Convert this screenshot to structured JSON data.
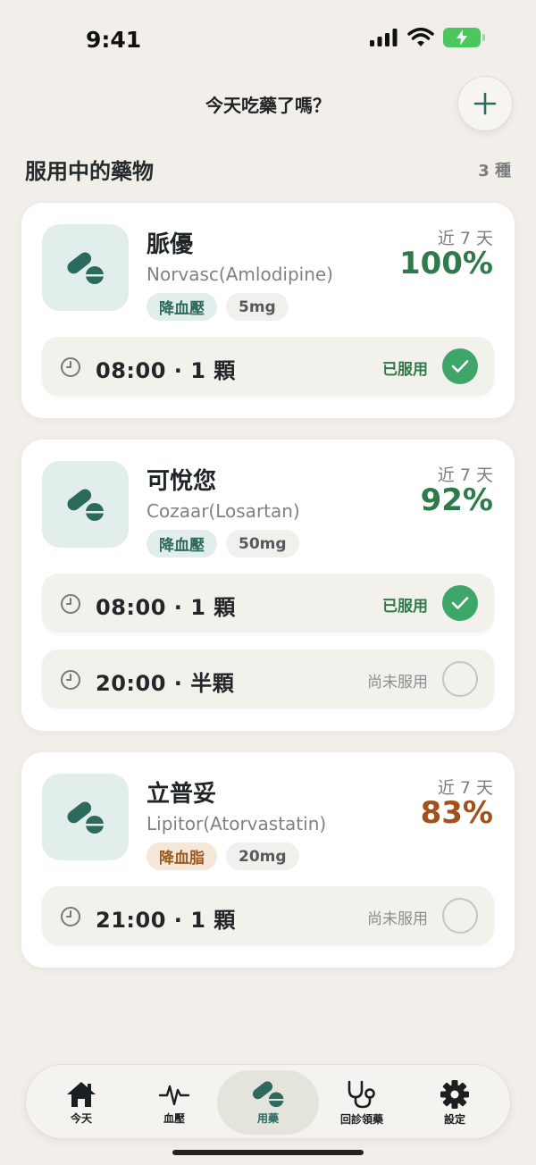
{
  "status_bar": {
    "time": "9:41"
  },
  "header": {
    "title": "今天吃藥了嗎？",
    "add_icon": "plus-icon"
  },
  "section": {
    "title": "服用中的藥物",
    "count": "3 種"
  },
  "colors": {
    "accent": "#2d6a5e",
    "taken": "#3fa66a",
    "good": "#2f7a4b",
    "warn": "#a0511c"
  },
  "medications": [
    {
      "name": "脈優",
      "generic": "Norvasc(Amlodipine)",
      "category": "降血壓",
      "dose": "5mg",
      "adherence_label": "近 7 天",
      "adherence": "100%",
      "doses": [
        {
          "time_text": "08:00 · 1 顆",
          "status": "已服用",
          "taken": true
        }
      ]
    },
    {
      "name": "可悅您",
      "generic": "Cozaar(Losartan)",
      "category": "降血壓",
      "dose": "50mg",
      "adherence_label": "近 7 天",
      "adherence": "92%",
      "doses": [
        {
          "time_text": "08:00 · 1 顆",
          "status": "已服用",
          "taken": true
        },
        {
          "time_text": "20:00 · 半顆",
          "status": "尚未服用",
          "taken": false
        }
      ]
    },
    {
      "name": "立普妥",
      "generic": "Lipitor(Atorvastatin)",
      "category": "降血脂",
      "dose": "20mg",
      "adherence_label": "近 7 天",
      "adherence": "83%",
      "doses": [
        {
          "time_text": "21:00 · 1 顆",
          "status": "尚未服用",
          "taken": false
        }
      ]
    }
  ],
  "tab_bar": {
    "tabs": [
      {
        "label": "今天",
        "icon": "home-icon"
      },
      {
        "label": "血壓",
        "icon": "heartbeat-icon"
      },
      {
        "label": "用藥",
        "icon": "pill-icon",
        "active": true
      },
      {
        "label": "回診領藥",
        "icon": "stethoscope-icon"
      },
      {
        "label": "設定",
        "icon": "gear-icon"
      }
    ]
  }
}
